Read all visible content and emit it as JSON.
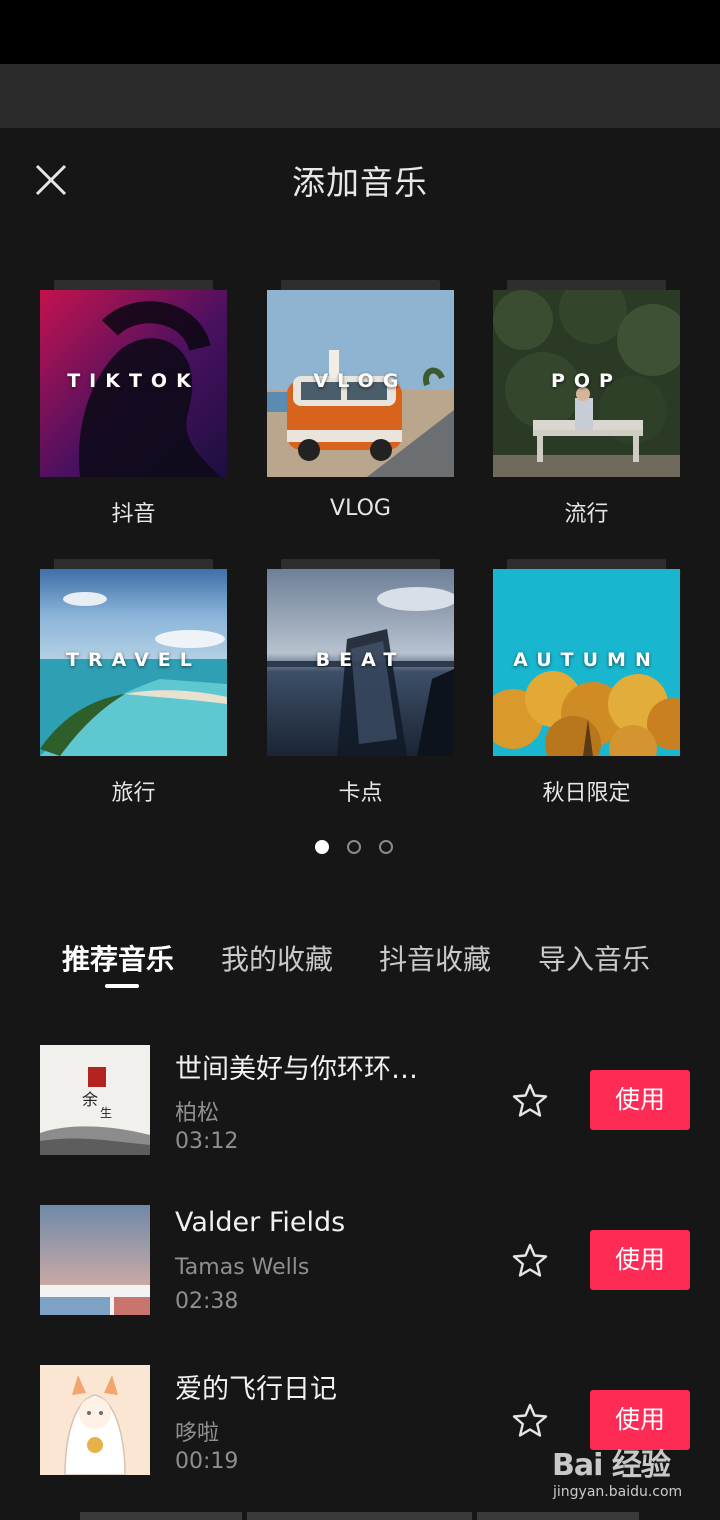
{
  "header": {
    "title": "添加音乐",
    "close_icon": "close-icon"
  },
  "categories": [
    {
      "label": "抖音",
      "cover_word": "TIKTOK"
    },
    {
      "label": "VLOG",
      "cover_word": "VLOG"
    },
    {
      "label": "流行",
      "cover_word": "POP"
    },
    {
      "label": "旅行",
      "cover_word": "TRAVEL"
    },
    {
      "label": "卡点",
      "cover_word": "BEAT"
    },
    {
      "label": "秋日限定",
      "cover_word": "AUTUMN"
    }
  ],
  "pager": {
    "total": 3,
    "active": 1
  },
  "tabs": [
    {
      "label": "推荐音乐",
      "active": true
    },
    {
      "label": "我的收藏",
      "active": false
    },
    {
      "label": "抖音收藏",
      "active": false
    },
    {
      "label": "导入音乐",
      "active": false
    }
  ],
  "songs": [
    {
      "title": "世间美好与你环环…",
      "artist": "柏松",
      "duration": "03:12",
      "use_label": "使用"
    },
    {
      "title": "Valder Fields",
      "artist": "Tamas Wells",
      "duration": "02:38",
      "use_label": "使用"
    },
    {
      "title": "爱的飞行日记",
      "artist": "哆啦",
      "duration": "00:19",
      "use_label": "使用"
    }
  ],
  "colors": {
    "accent": "#fe2c55",
    "background": "#161616"
  },
  "watermark": {
    "text": "Bai 经验",
    "url": "jingyan.baidu.com"
  }
}
